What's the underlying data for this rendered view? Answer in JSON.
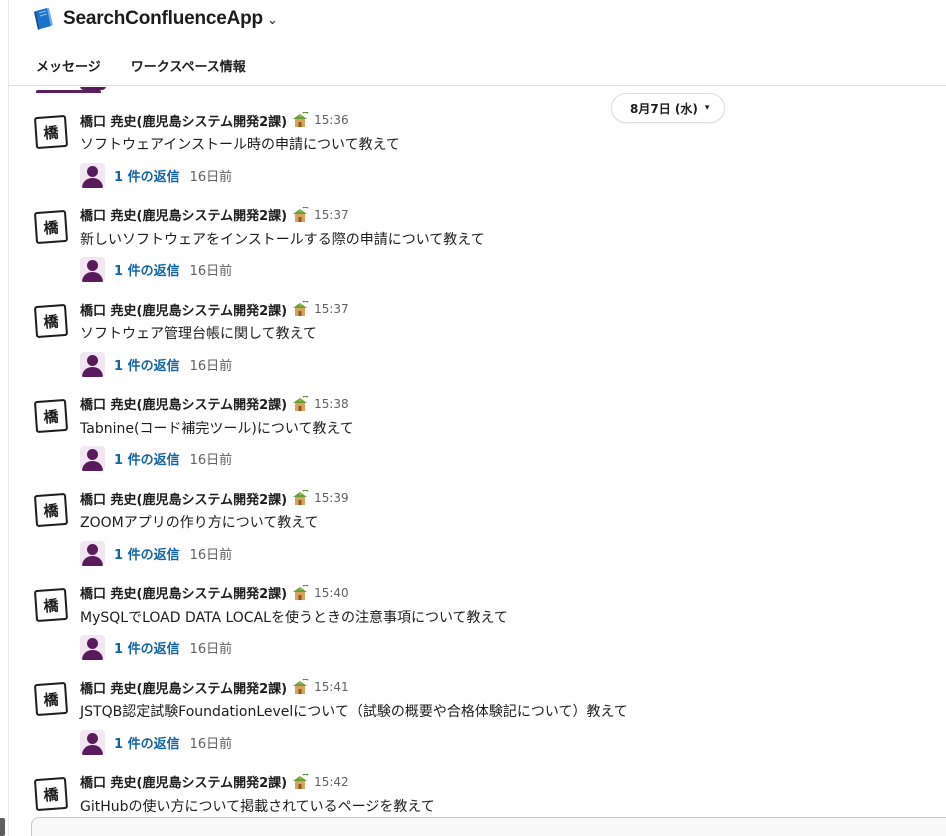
{
  "header": {
    "app_name": "SearchConfluenceApp",
    "tabs": [
      {
        "label": "メッセージ",
        "active": true
      },
      {
        "label": "ワークスペース情報",
        "active": false
      }
    ]
  },
  "date_divider": {
    "label": "8月7日 (水)"
  },
  "messages": [
    {
      "avatar_char": "橋",
      "sender": "橋口 尭史(鹿児島システム開発2課)",
      "time": "15:36",
      "text": "ソフトウェアインストール時の申請について教えて",
      "reply_count": "1 件の返信",
      "reply_time": "16日前"
    },
    {
      "avatar_char": "橋",
      "sender": "橋口 尭史(鹿児島システム開発2課)",
      "time": "15:37",
      "text": "新しいソフトウェアをインストールする際の申請について教えて",
      "reply_count": "1 件の返信",
      "reply_time": "16日前"
    },
    {
      "avatar_char": "橋",
      "sender": "橋口 尭史(鹿児島システム開発2課)",
      "time": "15:37",
      "text": "ソフトウェア管理台帳に関して教えて",
      "reply_count": "1 件の返信",
      "reply_time": "16日前"
    },
    {
      "avatar_char": "橋",
      "sender": "橋口 尭史(鹿児島システム開発2課)",
      "time": "15:38",
      "text": "Tabnine(コード補完ツール)について教えて",
      "reply_count": "1 件の返信",
      "reply_time": "16日前"
    },
    {
      "avatar_char": "橋",
      "sender": "橋口 尭史(鹿児島システム開発2課)",
      "time": "15:39",
      "text": "ZOOMアプリの作り方について教えて",
      "reply_count": "1 件の返信",
      "reply_time": "16日前"
    },
    {
      "avatar_char": "橋",
      "sender": "橋口 尭史(鹿児島システム開発2課)",
      "time": "15:40",
      "text": "MySQLでLOAD DATA LOCALを使うときの注意事項について教えて",
      "reply_count": "1 件の返信",
      "reply_time": "16日前"
    },
    {
      "avatar_char": "橋",
      "sender": "橋口 尭史(鹿児島システム開発2課)",
      "time": "15:41",
      "text": "JSTQB認定試験FoundationLevelについて（試験の概要や合格体験記について）教えて",
      "reply_count": "1 件の返信",
      "reply_time": "16日前"
    },
    {
      "avatar_char": "橋",
      "sender": "橋口 尭史(鹿児島システム開発2課)",
      "time": "15:42",
      "text": "GitHubの使い方について掲載されているページを教えて",
      "reply_count": "",
      "reply_time": ""
    }
  ],
  "colors": {
    "accent": "#5b1e5e",
    "link": "#1264a3",
    "muted": "#616061"
  },
  "icons": {
    "app": "blue-notebook-icon",
    "status": "palm-house-icon",
    "reply_avatar": "person-silhouette-icon"
  }
}
